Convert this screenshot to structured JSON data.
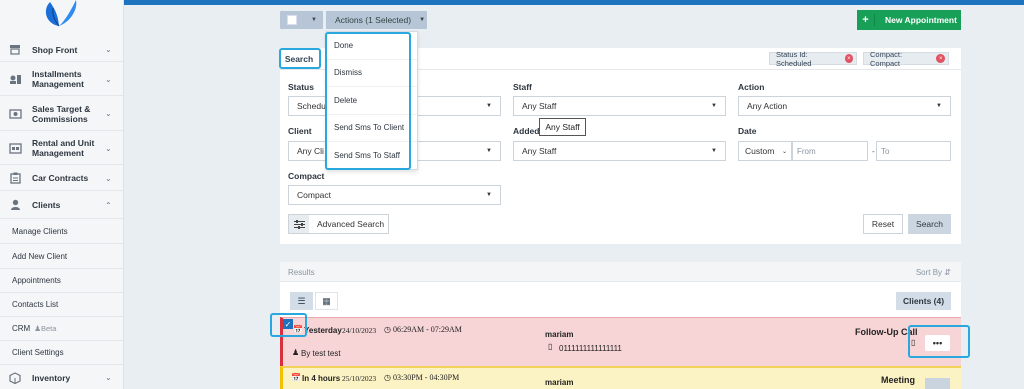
{
  "sidebar": {
    "items": [
      {
        "label": "Shop Front",
        "icon": "storefront-icon"
      },
      {
        "label": "Installments Management",
        "icon": "installments-icon"
      },
      {
        "label": "Sales Target & Commissions",
        "icon": "money-icon"
      },
      {
        "label": "Rental and Unit Management",
        "icon": "rental-icon"
      },
      {
        "label": "Car Contracts",
        "icon": "clipboard-icon"
      },
      {
        "label": "Clients",
        "icon": "user-icon"
      }
    ],
    "sub_items": [
      "Manage Clients",
      "Add New Client",
      "Appointments",
      "Contacts List",
      "CRM",
      "Client Settings"
    ],
    "beta_label": "Beta",
    "bottom_item": {
      "label": "Inventory",
      "icon": "box-icon"
    }
  },
  "toolbar": {
    "actions_label": "Actions (1 Selected)",
    "new_appointment_label": "New Appointment"
  },
  "actions_menu": [
    "Done",
    "Dismiss",
    "Delete",
    "Send Sms To Client",
    "Send Sms To Staff"
  ],
  "filter": {
    "search_tab": "Search",
    "tags": [
      "Status Id: Scheduled",
      "Compact: Compact"
    ],
    "status": {
      "label": "Status",
      "value": "Schedule"
    },
    "staff": {
      "label": "Staff",
      "value": "Any Staff"
    },
    "action": {
      "label": "Action",
      "value": "Any Action"
    },
    "client": {
      "label": "Client",
      "value": "Any Cli"
    },
    "added": {
      "label": "Added",
      "value": "Any Staff"
    },
    "date": {
      "label": "Date",
      "value": "Custom",
      "from_placeholder": "From",
      "to_placeholder": "To",
      "separator": "-"
    },
    "compact": {
      "label": "Compact",
      "value": "Compact"
    },
    "advanced_label": "Advanced Search",
    "reset_label": "Reset",
    "search_label": "Search",
    "tooltip": "Any Staff"
  },
  "results": {
    "title": "Results",
    "sort_label": "Sort By",
    "clients_label": "Clients (4)",
    "rows": [
      {
        "day": "Yesterday",
        "date": "24/10/2023",
        "time": "06:29AM - 07:29AM",
        "by": "By test test",
        "client": "mariam",
        "phone": "0111111111111111",
        "type": "Follow-Up Call",
        "status_color": "#d9303f"
      },
      {
        "day": "In 4 hours",
        "date": "25/10/2023",
        "time": "03:30PM - 04:30PM",
        "client": "mariam",
        "type": "Meeting",
        "status_color": "#f2c200"
      }
    ]
  },
  "colors": {
    "accent": "#1e73be",
    "highlight": "#29a8e0",
    "success": "#18a058"
  }
}
